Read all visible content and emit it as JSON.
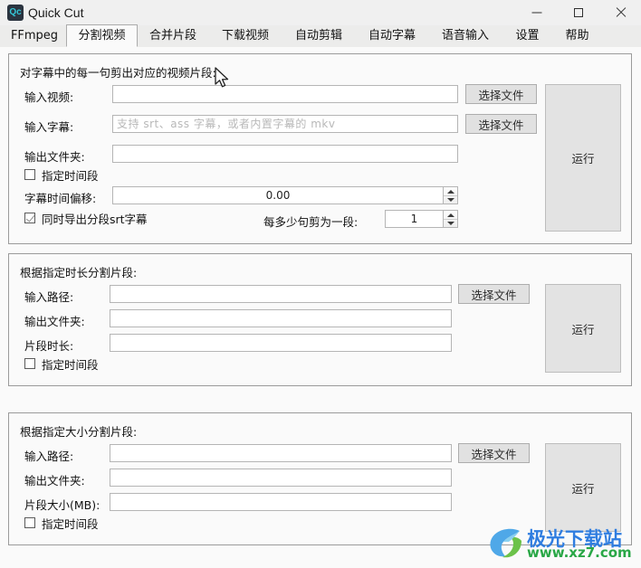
{
  "window": {
    "app_icon_text": "Qc",
    "title": "Quick Cut",
    "controls": {
      "minimize": "minimize-icon",
      "maximize": "maximize-icon",
      "close": "close-icon"
    }
  },
  "tabs": [
    {
      "label": "FFmpeg",
      "active": false
    },
    {
      "label": "分割视频",
      "active": true
    },
    {
      "label": "合并片段",
      "active": false
    },
    {
      "label": "下载视频",
      "active": false
    },
    {
      "label": "自动剪辑",
      "active": false
    },
    {
      "label": "自动字幕",
      "active": false
    },
    {
      "label": "语音输入",
      "active": false
    },
    {
      "label": "设置",
      "active": false
    },
    {
      "label": "帮助",
      "active": false
    }
  ],
  "panels": [
    {
      "id": "subtitle-split",
      "title": "对字幕中的每一句剪出对应的视频片段:",
      "fields": [
        {
          "label": "输入视频:",
          "value": "",
          "placeholder": ""
        },
        {
          "label": "输入字幕:",
          "value": "",
          "placeholder": "支持 srt、ass 字幕，或者内置字幕的 mkv"
        },
        {
          "label": "输出文件夹:",
          "value": "",
          "placeholder": ""
        }
      ],
      "time_range_checkbox": {
        "label": "指定时间段",
        "checked": false
      },
      "offset": {
        "label": "字幕时间偏移:",
        "value": "0.00"
      },
      "export_srt_checkbox": {
        "label": "同时导出分段srt字幕",
        "checked": true
      },
      "sentences_per_clip": {
        "label": "每多少句剪为一段:",
        "value": "1"
      },
      "choose_file_buttons": [
        "选择文件",
        "选择文件"
      ],
      "run_button": "运行"
    },
    {
      "id": "duration-split",
      "title": "根据指定时长分割片段:",
      "fields": [
        {
          "label": "输入路径:",
          "value": "",
          "placeholder": ""
        },
        {
          "label": "输出文件夹:",
          "value": "",
          "placeholder": ""
        },
        {
          "label": "片段时长:",
          "value": "",
          "placeholder": ""
        }
      ],
      "time_range_checkbox": {
        "label": "指定时间段",
        "checked": false
      },
      "choose_file_buttons": [
        "选择文件"
      ],
      "run_button": "运行"
    },
    {
      "id": "size-split",
      "title": "根据指定大小分割片段:",
      "fields": [
        {
          "label": "输入路径:",
          "value": "",
          "placeholder": ""
        },
        {
          "label": "输出文件夹:",
          "value": "",
          "placeholder": ""
        },
        {
          "label": "片段大小(MB):",
          "value": "",
          "placeholder": ""
        }
      ],
      "time_range_checkbox": {
        "label": "指定时间段",
        "checked": false
      },
      "choose_file_buttons": [
        "选择文件"
      ],
      "run_button": "运行"
    }
  ],
  "watermark": {
    "text_cn": "极光下载站",
    "url": "www.xz7.com",
    "color_cn": "#2f7de0",
    "color_url": "#29a746"
  },
  "colors": {
    "window_bg": "#f0f0f0",
    "content_bg": "#fafafa",
    "panel_border": "#9b9b9b",
    "input_border": "#b5b5b5",
    "button_bg": "#e1e1e1",
    "active_tab_bg": "#fafafa",
    "icon_accent": "#35c7d8"
  }
}
